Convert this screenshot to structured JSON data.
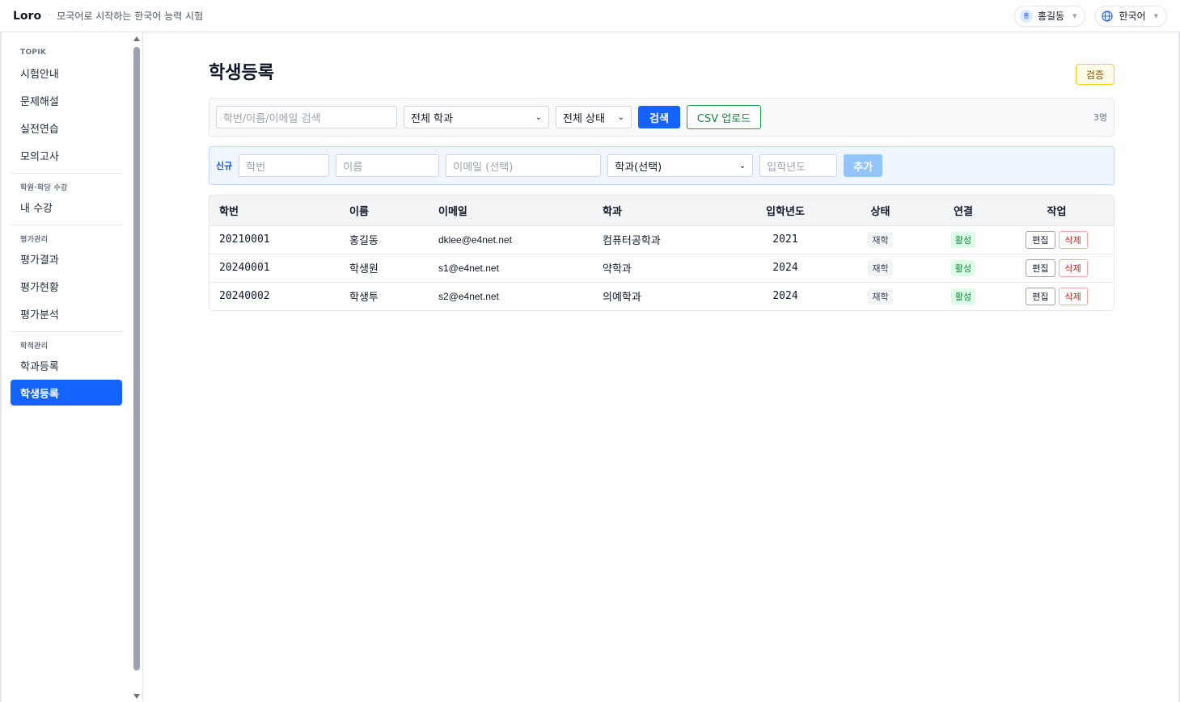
{
  "header": {
    "brand": "Loro",
    "separator": "·",
    "tagline": "모국어로 시작하는 한국어 능력 시험",
    "user_avatar": "홍",
    "user_name": "홍길동",
    "language": "한국어"
  },
  "sidebar": {
    "sections": [
      {
        "title": "TOPIK",
        "items": [
          "시험안내",
          "문제해설",
          "실전연습",
          "모의고사"
        ]
      },
      {
        "title": "학원·학당 수강",
        "items": [
          "내 수강"
        ]
      },
      {
        "title": "평가관리",
        "items": [
          "평가결과",
          "평가현황",
          "평가분석"
        ]
      },
      {
        "title": "학적관리",
        "items": [
          "학과등록",
          "학생등록"
        ]
      }
    ],
    "active_item": "학생등록"
  },
  "page": {
    "title": "학생등록",
    "verify_badge": "검증"
  },
  "filter": {
    "search_placeholder": "학번/이름/이메일 검색",
    "dept_select": "전체 학과",
    "status_select": "전체 상태",
    "search_button": "검색",
    "csv_button": "CSV 업로드",
    "count": "3명"
  },
  "new_form": {
    "label": "신규",
    "id_placeholder": "학번",
    "name_placeholder": "이름",
    "email_placeholder": "이메일 (선택)",
    "dept_select": "학과(선택)",
    "year_placeholder": "입학년도",
    "add_button": "추가"
  },
  "table": {
    "headers": [
      "학번",
      "이름",
      "이메일",
      "학과",
      "입학년도",
      "상태",
      "연결",
      "작업"
    ],
    "rows": [
      {
        "id": "20210001",
        "name": "홍길동",
        "email": "dklee@e4net.net",
        "dept": "컴퓨터공학과",
        "year": "2021",
        "status": "재학",
        "link": "활성"
      },
      {
        "id": "20240001",
        "name": "학생원",
        "email": "s1@e4net.net",
        "dept": "약학과",
        "year": "2024",
        "status": "재학",
        "link": "활성"
      },
      {
        "id": "20240002",
        "name": "학생투",
        "email": "s2@e4net.net",
        "dept": "의예학과",
        "year": "2024",
        "status": "재학",
        "link": "활성"
      }
    ],
    "edit_label": "편집",
    "delete_label": "삭제"
  }
}
